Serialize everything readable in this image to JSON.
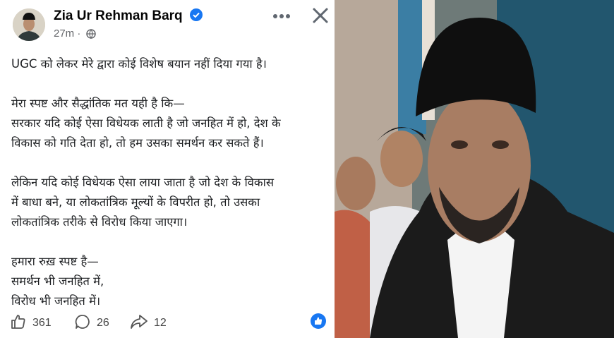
{
  "post": {
    "author": "Zia Ur Rehman Barq",
    "time": "27m",
    "paragraphs": [
      [
        "UGC को लेकर मेरे द्वारा कोई विशेष बयान नहीं दिया गया है।"
      ],
      [
        "मेरा स्पष्ट और सैद्धांतिक मत यही है कि—",
        "सरकार यदि कोई ऐसा विधेयक लाती है जो जनहित में हो, देश के",
        "विकास को गति देता हो, तो हम उसका समर्थन कर सकते हैं।"
      ],
      [
        "लेकिन यदि कोई विधेयक ऐसा लाया जाता है जो देश के विकास",
        "में बाधा बने, या लोकतांत्रिक मूल्यों के विपरीत हो, तो उसका",
        "लोकतांत्रिक तरीके से विरोध किया जाएगा।"
      ],
      [
        "हमारा रुख़ स्पष्ट है—",
        "समर्थन भी जनहित में,",
        "विरोध भी जनहित में।"
      ]
    ]
  },
  "actions": {
    "likes": "361",
    "comments": "26",
    "shares": "12"
  },
  "icons": {
    "verified": "verified-badge-icon",
    "audience": "globe-icon",
    "more": "more-dots-icon",
    "close": "close-icon",
    "like": "thumbs-up-icon",
    "comment": "comment-icon",
    "share": "share-icon",
    "reaction": "like-reaction-icon"
  },
  "colors": {
    "verified": "#1877f2",
    "meta": "#65676b",
    "reaction": "#1877f2"
  }
}
